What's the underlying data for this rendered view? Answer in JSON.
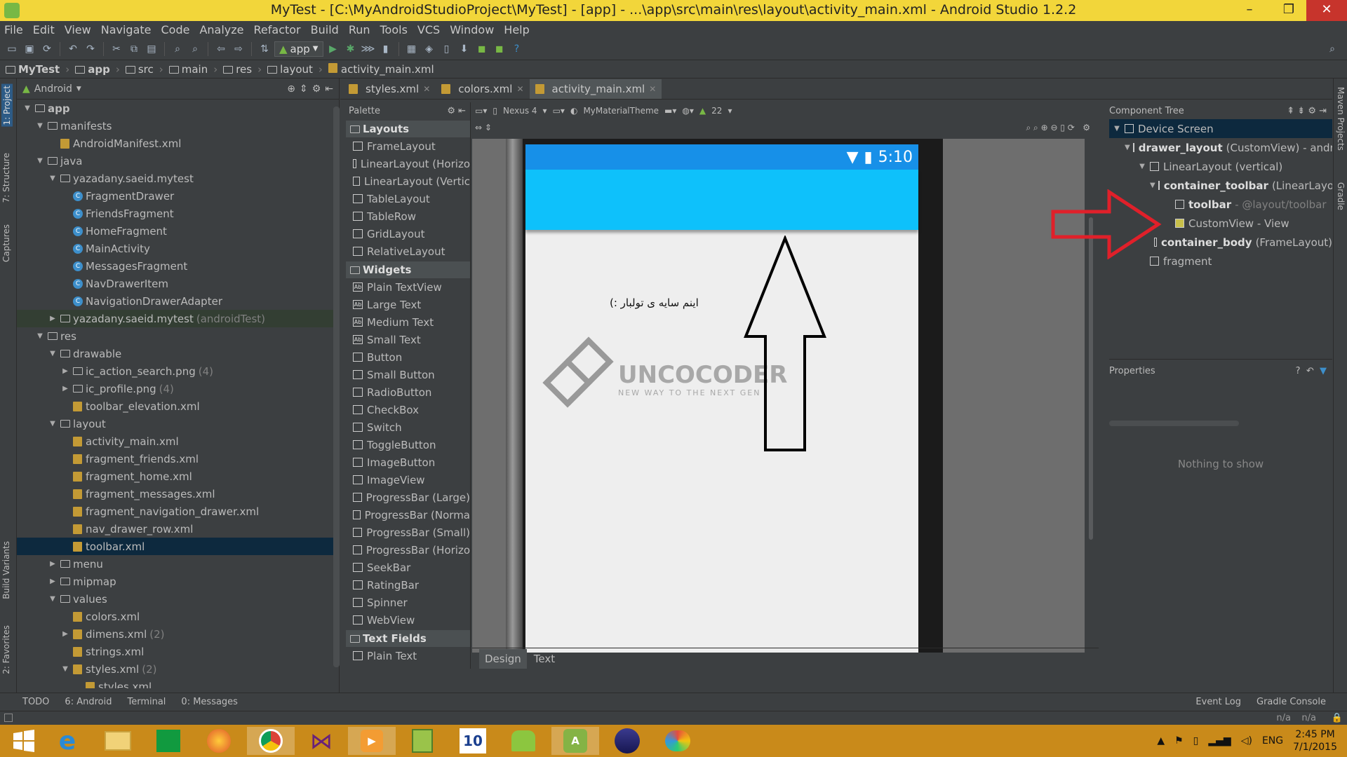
{
  "window": {
    "title": "MyTest - [C:\\MyAndroidStudioProject\\MyTest] - [app] - ...\\app\\src\\main\\res\\layout\\activity_main.xml - Android Studio 1.2.2",
    "minimize": "–",
    "restore": "❐",
    "close": "✕"
  },
  "menu": [
    "File",
    "Edit",
    "View",
    "Navigate",
    "Code",
    "Analyze",
    "Refactor",
    "Build",
    "Run",
    "Tools",
    "VCS",
    "Window",
    "Help"
  ],
  "toolbar": {
    "run_config": "app"
  },
  "breadcrumb": [
    "MyTest",
    "app",
    "src",
    "main",
    "res",
    "layout",
    "activity_main.xml"
  ],
  "left_tabs": [
    "1: Project",
    "7: Structure",
    "Captures",
    "Build Variants",
    "2: Favorites"
  ],
  "right_tabs": [
    "Maven Projects",
    "Gradle"
  ],
  "project": {
    "view": "Android",
    "tree": [
      {
        "d": 0,
        "t": "v",
        "label": "app",
        "k": "fold",
        "bold": true
      },
      {
        "d": 1,
        "t": "v",
        "label": "manifests",
        "k": "fold"
      },
      {
        "d": 2,
        "t": "",
        "label": "AndroidManifest.xml",
        "k": "xml"
      },
      {
        "d": 1,
        "t": "v",
        "label": "java",
        "k": "fold"
      },
      {
        "d": 2,
        "t": "v",
        "label": "yazadany.saeid.mytest",
        "k": "fold"
      },
      {
        "d": 3,
        "t": "",
        "label": "FragmentDrawer",
        "k": "cls"
      },
      {
        "d": 3,
        "t": "",
        "label": "FriendsFragment",
        "k": "cls"
      },
      {
        "d": 3,
        "t": "",
        "label": "HomeFragment",
        "k": "cls"
      },
      {
        "d": 3,
        "t": "",
        "label": "MainActivity",
        "k": "cls"
      },
      {
        "d": 3,
        "t": "",
        "label": "MessagesFragment",
        "k": "cls"
      },
      {
        "d": 3,
        "t": "",
        "label": "NavDrawerItem",
        "k": "cls"
      },
      {
        "d": 3,
        "t": "",
        "label": "NavigationDrawerAdapter",
        "k": "cls"
      },
      {
        "d": 2,
        "t": ">",
        "label": "yazadany.saeid.mytest",
        "k": "fold",
        "extra": "(androidTest)",
        "hl": true
      },
      {
        "d": 1,
        "t": "v",
        "label": "res",
        "k": "fold"
      },
      {
        "d": 2,
        "t": "v",
        "label": "drawable",
        "k": "fold"
      },
      {
        "d": 3,
        "t": ">",
        "label": "ic_action_search.png",
        "k": "fold",
        "extra": "(4)"
      },
      {
        "d": 3,
        "t": ">",
        "label": "ic_profile.png",
        "k": "fold",
        "extra": "(4)"
      },
      {
        "d": 3,
        "t": "",
        "label": "toolbar_elevation.xml",
        "k": "xml"
      },
      {
        "d": 2,
        "t": "v",
        "label": "layout",
        "k": "fold"
      },
      {
        "d": 3,
        "t": "",
        "label": "activity_main.xml",
        "k": "xml"
      },
      {
        "d": 3,
        "t": "",
        "label": "fragment_friends.xml",
        "k": "xml"
      },
      {
        "d": 3,
        "t": "",
        "label": "fragment_home.xml",
        "k": "xml"
      },
      {
        "d": 3,
        "t": "",
        "label": "fragment_messages.xml",
        "k": "xml"
      },
      {
        "d": 3,
        "t": "",
        "label": "fragment_navigation_drawer.xml",
        "k": "xml"
      },
      {
        "d": 3,
        "t": "",
        "label": "nav_drawer_row.xml",
        "k": "xml"
      },
      {
        "d": 3,
        "t": "",
        "label": "toolbar.xml",
        "k": "xml",
        "sel": true
      },
      {
        "d": 2,
        "t": ">",
        "label": "menu",
        "k": "fold"
      },
      {
        "d": 2,
        "t": ">",
        "label": "mipmap",
        "k": "fold"
      },
      {
        "d": 2,
        "t": "v",
        "label": "values",
        "k": "fold"
      },
      {
        "d": 3,
        "t": "",
        "label": "colors.xml",
        "k": "xml"
      },
      {
        "d": 3,
        "t": ">",
        "label": "dimens.xml",
        "k": "xml",
        "extra": "(2)"
      },
      {
        "d": 3,
        "t": "",
        "label": "strings.xml",
        "k": "xml"
      },
      {
        "d": 3,
        "t": "v",
        "label": "styles.xml",
        "k": "xml",
        "extra": "(2)"
      },
      {
        "d": 4,
        "t": "",
        "label": "styles.xml",
        "k": "xml"
      }
    ]
  },
  "tabs": [
    {
      "label": "styles.xml"
    },
    {
      "label": "colors.xml"
    },
    {
      "label": "activity_main.xml",
      "active": true
    }
  ],
  "palette": {
    "header": "Palette",
    "groups": [
      {
        "name": "Layouts",
        "items": [
          "FrameLayout",
          "LinearLayout (Horizo",
          "LinearLayout (Vertic",
          "TableLayout",
          "TableRow",
          "GridLayout",
          "RelativeLayout"
        ]
      },
      {
        "name": "Widgets",
        "items": [
          "Plain TextView",
          "Large Text",
          "Medium Text",
          "Small Text",
          "Button",
          "Small Button",
          "RadioButton",
          "CheckBox",
          "Switch",
          "ToggleButton",
          "ImageButton",
          "ImageView",
          "ProgressBar (Large)",
          "ProgressBar (Norma",
          "ProgressBar (Small)",
          "ProgressBar (Horizo",
          "SeekBar",
          "RatingBar",
          "Spinner",
          "WebView"
        ]
      },
      {
        "name": "Text Fields",
        "items": [
          "Plain Text"
        ]
      }
    ]
  },
  "design_toolbar": {
    "device": "Nexus 4",
    "theme": "MyMaterialTheme",
    "api": "22"
  },
  "preview": {
    "time": "5:10",
    "body_text": "اینم سایه ی تولبار :)",
    "logo_main": "UNCOCODER",
    "logo_sub": "NEW WAY TO THE NEXT GEN"
  },
  "bottom_tabs": [
    {
      "label": "Design",
      "active": true
    },
    {
      "label": "Text"
    }
  ],
  "component_tree": {
    "header": "Component Tree",
    "rows": [
      {
        "d": 0,
        "name": "Device Screen",
        "desc": "",
        "sel": true
      },
      {
        "d": 1,
        "name": "drawer_layout",
        "desc": "(CustomView) - androic",
        "bold": true
      },
      {
        "d": 2,
        "name": "LinearLayout",
        "desc": "(vertical)"
      },
      {
        "d": 3,
        "name": "container_toolbar",
        "desc": "(LinearLayout)",
        "bold": true
      },
      {
        "d": 4,
        "name": "toolbar",
        "desc": "- @layout/toolbar",
        "bold": true
      },
      {
        "d": 4,
        "name": "CustomView - View",
        "desc": ""
      },
      {
        "d": 3,
        "name": "container_body",
        "desc": "(FrameLayout)",
        "bold": true
      },
      {
        "d": 2,
        "name": "fragment",
        "desc": ""
      }
    ]
  },
  "properties": {
    "header": "Properties",
    "empty": "Nothing to show"
  },
  "bottom_tools": [
    "TODO",
    "6: Android",
    "Terminal",
    "0: Messages"
  ],
  "bottom_right_tools": [
    "Event Log",
    "Gradle Console"
  ],
  "status": {
    "pos1": "n/a",
    "pos2": "n/a"
  },
  "taskbar": {
    "lang": "ENG",
    "time": "2:45 PM",
    "date": "7/1/2015"
  },
  "colors": {
    "titlebar": "#f2d63a",
    "status_bar": "#1790e8",
    "app_bar": "#0ec1fb",
    "arrow_red": "#e0202a",
    "taskbar": "#c98a1a"
  }
}
